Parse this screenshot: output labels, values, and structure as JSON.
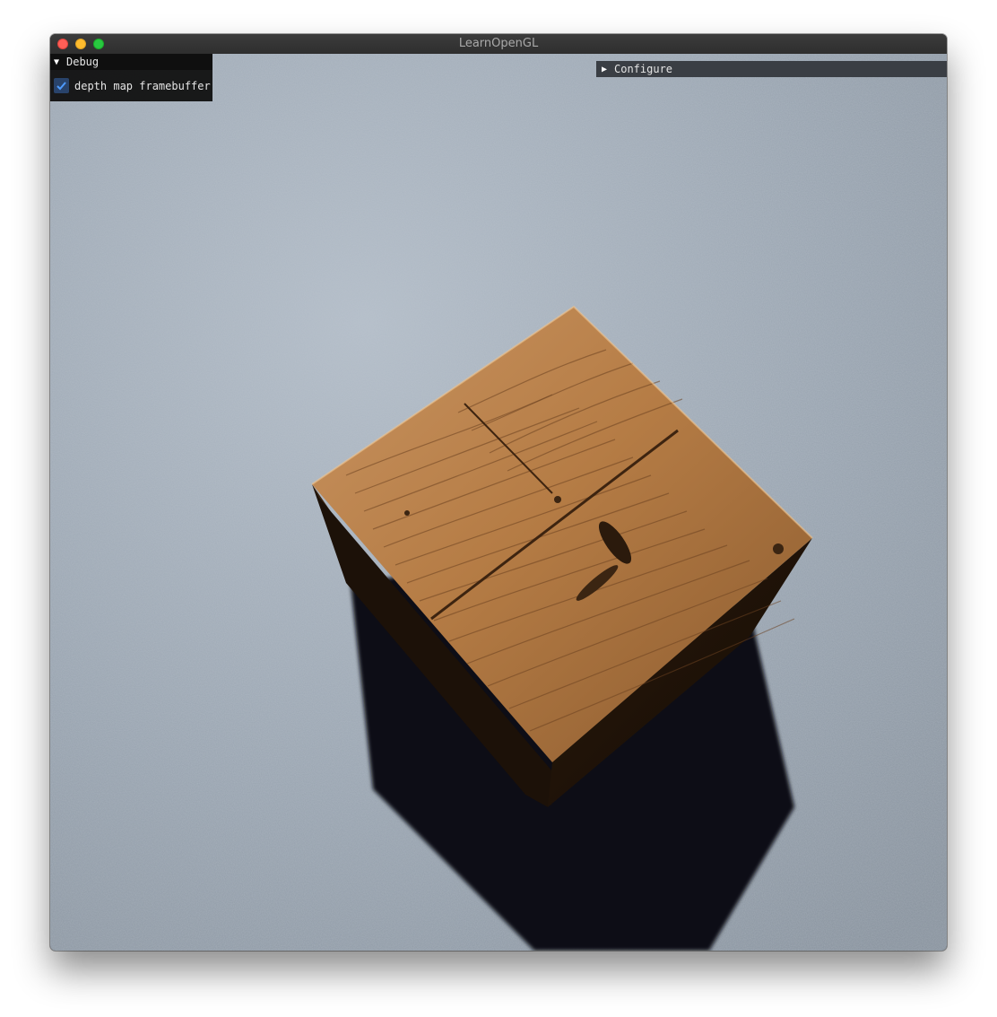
{
  "window": {
    "title": "LearnOpenGL",
    "controls": [
      "close",
      "minimize",
      "maximize"
    ]
  },
  "debug_panel": {
    "title": "Debug",
    "collapsed": false,
    "checkbox_label": "depth map framebuffer",
    "checkbox_checked": true
  },
  "configure_panel": {
    "title": "Configure",
    "collapsed": true
  },
  "scene": {
    "description_icon": "wooden-crate",
    "floor_color": "#8c96a3",
    "wood_color": "#b9834f",
    "shadow_color": "#0c0f14"
  }
}
